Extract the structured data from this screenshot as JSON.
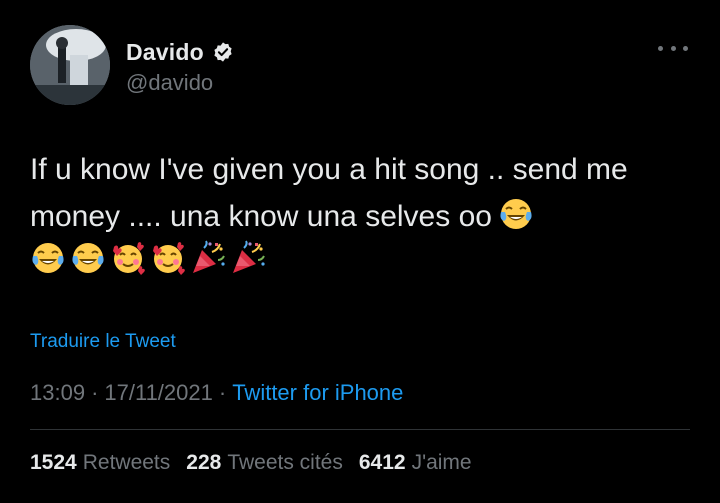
{
  "author": {
    "display_name": "Davido",
    "handle": "@davido",
    "verified": true
  },
  "tweet": {
    "text": "If u know I've given you a hit song .. send me money .... una know una selves oo",
    "emojis": [
      "tears-of-joy",
      "tears-of-joy",
      "tears-of-joy",
      "smiling-face-with-hearts",
      "smiling-face-with-hearts",
      "party-popper",
      "party-popper"
    ],
    "translate_label": "Traduire le Tweet",
    "time": "13:09",
    "date": "17/11/2021",
    "separator": "·",
    "source": "Twitter for iPhone"
  },
  "stats": {
    "retweets_count": "1524",
    "retweets_label": "Retweets",
    "quotes_count": "228",
    "quotes_label": "Tweets cités",
    "likes_count": "6412",
    "likes_label": "J'aime"
  },
  "colors": {
    "background": "#000000",
    "text": "#e7e9ea",
    "secondary": "#71767b",
    "link": "#1d9bf0",
    "divider": "#2f3336"
  },
  "icons": {
    "verified": "verified-badge-icon",
    "more": "more-options-icon"
  }
}
